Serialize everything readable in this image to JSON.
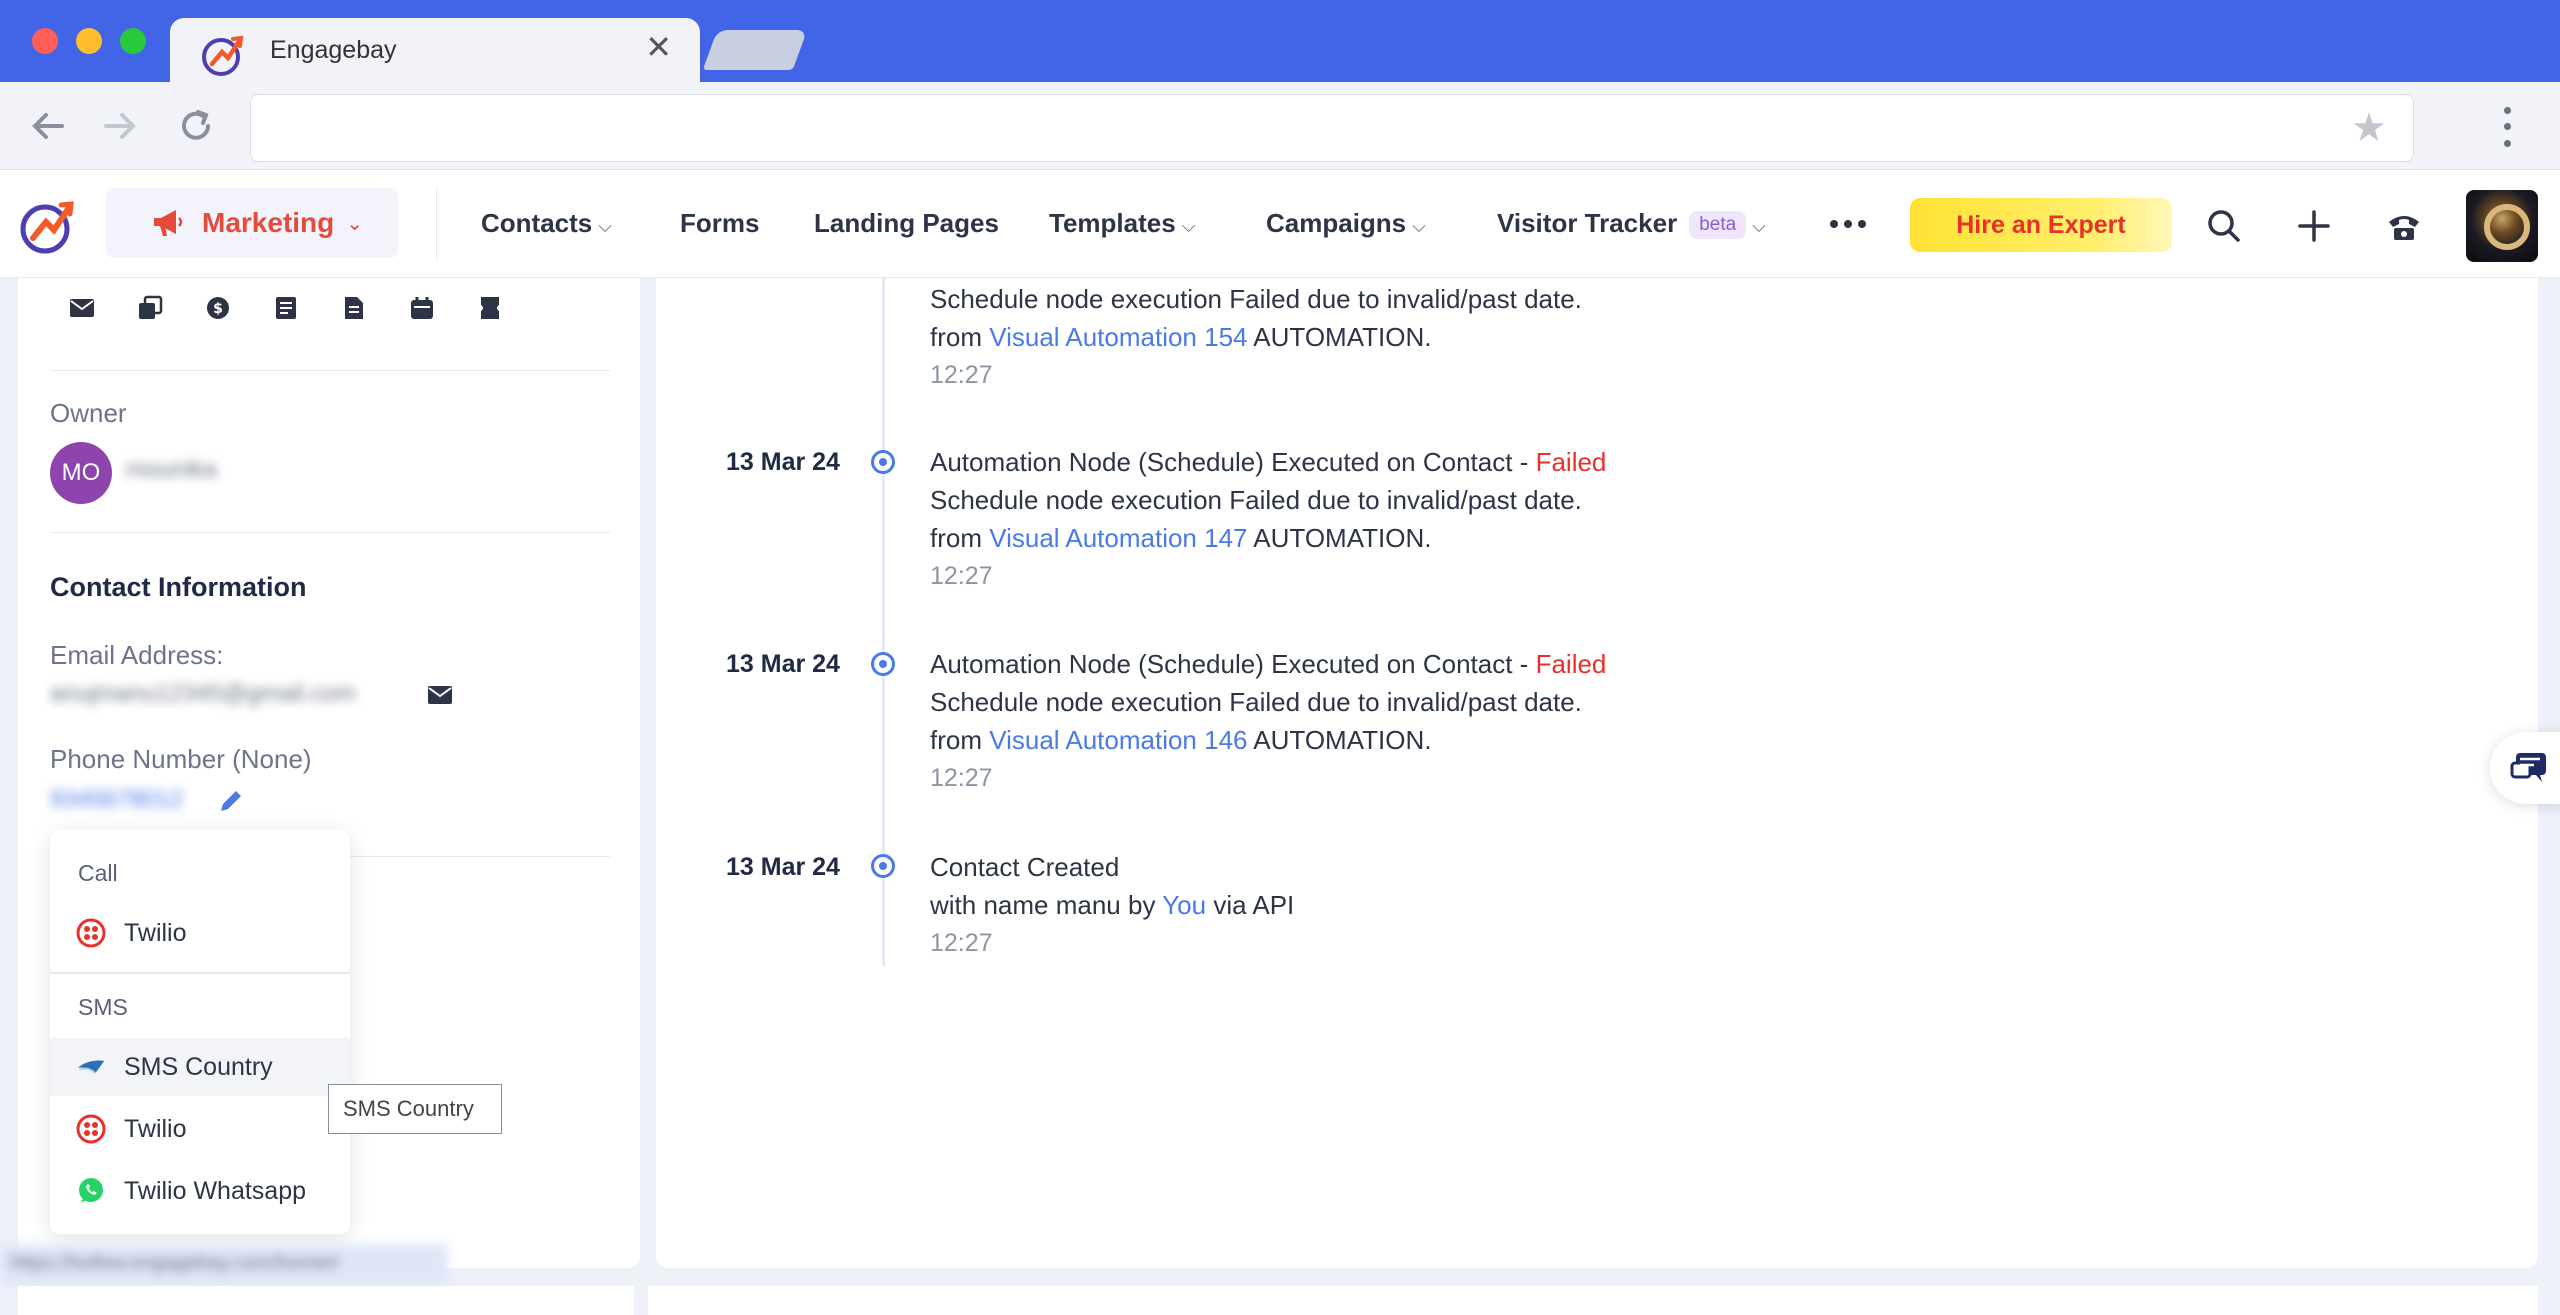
{
  "browser": {
    "tab_title": "Engagebay",
    "tab_close": "✕",
    "address": ""
  },
  "header": {
    "module": "Marketing",
    "nav": [
      {
        "label": "Contacts",
        "has_dropdown": true
      },
      {
        "label": "Forms",
        "has_dropdown": false
      },
      {
        "label": "Landing Pages",
        "has_dropdown": false
      },
      {
        "label": "Templates",
        "has_dropdown": true
      },
      {
        "label": "Campaigns",
        "has_dropdown": true
      },
      {
        "label": "Visitor Tracker",
        "badge": "beta",
        "has_dropdown": true
      }
    ],
    "hire_button": "Hire an Expert",
    "icons": [
      "more-icon",
      "search-icon",
      "plus-icon",
      "phone-icon",
      "user-avatar"
    ]
  },
  "contact": {
    "action_icons": [
      "email-icon",
      "copy-icon",
      "deal-icon",
      "note-icon",
      "document-icon",
      "calendar-icon",
      "ticket-icon"
    ],
    "owner_label": "Owner",
    "owner_initials": "MO",
    "owner_name": "mounika",
    "section_title": "Contact Information",
    "email_label": "Email Address:",
    "email_value": "anujmanu12345@gmail.com",
    "phone_label": "Phone Number (None)",
    "phone_value": "9345678012"
  },
  "dropdown": {
    "call_header": "Call",
    "call_items": [
      {
        "label": "Twilio",
        "icon": "twilio-icon"
      }
    ],
    "sms_header": "SMS",
    "sms_items": [
      {
        "label": "SMS Country",
        "icon": "sms-country-icon",
        "hovered": true
      },
      {
        "label": "Twilio",
        "icon": "twilio-icon"
      },
      {
        "label": "Twilio Whatsapp",
        "icon": "whatsapp-icon"
      }
    ]
  },
  "tooltip": "SMS Country",
  "status_url": "https://hollow.engagebay.com/home#",
  "timeline": [
    {
      "date": "",
      "line1_prefix": "",
      "line1_status": "",
      "line2": "Schedule node execution Failed due to invalid/past date.",
      "from": "from",
      "link": "Visual Automation 154",
      "suffix": "AUTOMATION.",
      "time": "12:27"
    },
    {
      "date": "13 Mar 24",
      "line1_prefix": "Automation Node (Schedule) Executed on Contact - ",
      "line1_status": "Failed",
      "line2": "Schedule node execution Failed due to invalid/past date.",
      "from": "from",
      "link": "Visual Automation 147",
      "suffix": "AUTOMATION.",
      "time": "12:27"
    },
    {
      "date": "13 Mar 24",
      "line1_prefix": "Automation Node (Schedule) Executed on Contact - ",
      "line1_status": "Failed",
      "line2": "Schedule node execution Failed due to invalid/past date.",
      "from": "from",
      "link": "Visual Automation 146",
      "suffix": "AUTOMATION.",
      "time": "12:27"
    },
    {
      "date": "13 Mar 24",
      "title": "Contact Created",
      "detail_prefix": "with name manu by",
      "detail_link": "You",
      "detail_suffix": "via API",
      "time": "12:27"
    }
  ],
  "colors": {
    "browser_bar": "#4264e6",
    "accent_blue": "#4a7ae6",
    "failed_red": "#e8312a",
    "marketing_red": "#e64a3b",
    "hire_yellow": "#ffe234",
    "owner_avatar": "#8e44ad"
  }
}
